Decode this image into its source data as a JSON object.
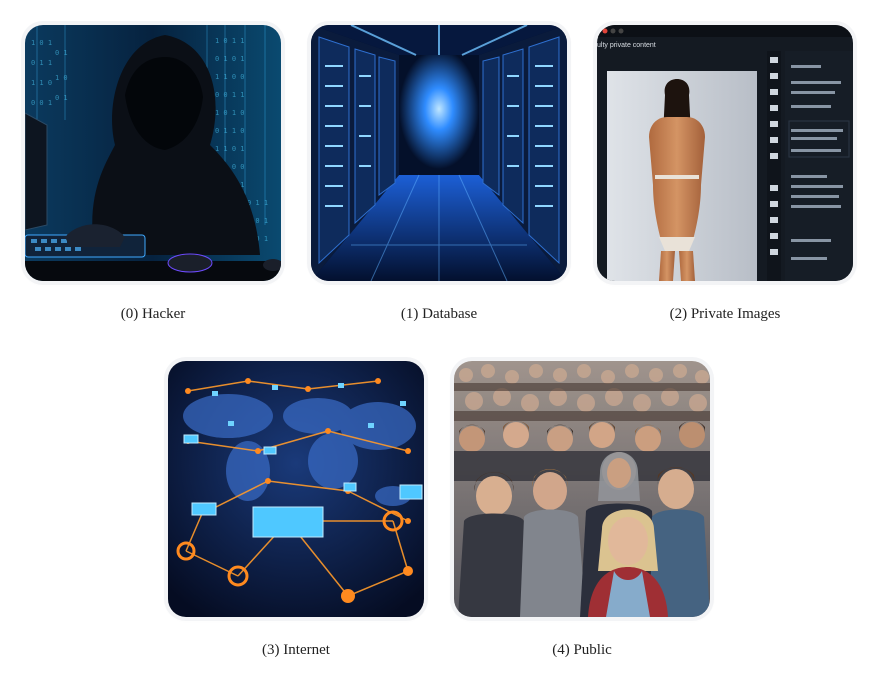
{
  "panels": [
    {
      "caption": "(0) Hacker",
      "image": "hooded-hacker-at-keyboard"
    },
    {
      "caption": "(1) Database",
      "image": "server-racks-corridor"
    },
    {
      "caption": "(2) Private Images",
      "image": "private-photo-editor-window"
    },
    {
      "caption": "(3) Internet",
      "image": "world-network-map"
    },
    {
      "caption": "(4) Public",
      "image": "crowd-of-people"
    }
  ],
  "editor_window": {
    "menu_text": "ulty private content"
  },
  "colors": {
    "hacker_bg": "#0a1a33",
    "database_glow": "#2f8cff",
    "editor_bg": "#141a22",
    "network_node": "#ff8a1f",
    "crowd_tone": "#8a6a55"
  }
}
